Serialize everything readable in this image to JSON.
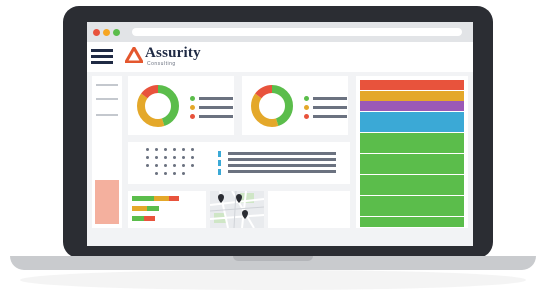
{
  "brand": {
    "name": "Assurity",
    "tagline": "Consulting",
    "logo_color": "#e4572e",
    "text_color": "#1f2a44"
  },
  "window": {
    "traffic_lights": [
      "#e8533c",
      "#f6a623",
      "#5bbd4b"
    ]
  },
  "icons": {
    "menu": "hamburger-menu-icon",
    "map_pins": "map-pin-icon"
  },
  "widgets": {
    "donut_1": {
      "segments": [
        {
          "color": "#5bbd4b",
          "value": 45
        },
        {
          "color": "#e4a82a",
          "value": 40
        },
        {
          "color": "#e8533c",
          "value": 15
        }
      ]
    },
    "donut_2": {
      "segments": [
        {
          "color": "#5bbd4b",
          "value": 45
        },
        {
          "color": "#e4a82a",
          "value": 40
        },
        {
          "color": "#e8533c",
          "value": 15
        }
      ]
    },
    "legend_colors": [
      "#5bbd4b",
      "#e4a82a",
      "#e8533c"
    ],
    "stripes": [
      "#e8533c",
      "#e4a82a",
      "#9b59b6",
      "#3ba9d6",
      "#3ba9d6",
      "#5bbd4b",
      "#5bbd4b",
      "#5bbd4b",
      "#5bbd4b",
      "#5bbd4b",
      "#5bbd4b",
      "#5bbd4b",
      "#5bbd4b",
      "#5bbd4b"
    ],
    "hbars": [
      {
        "color": "#5bbd4b",
        "value": 0.78
      },
      {
        "color": "#e4a82a",
        "value": 0.55
      },
      {
        "color": "#e8533c",
        "value": 0.35
      },
      {
        "color": "#5bbd4b",
        "value": 0.42
      },
      {
        "color": "#e8533c",
        "value": 0.4
      }
    ]
  }
}
